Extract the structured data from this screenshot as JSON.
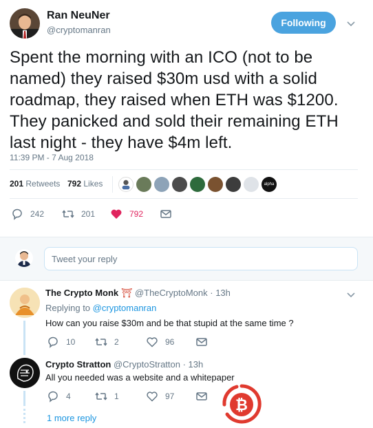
{
  "tweet": {
    "author_name": "Ran NeuNer",
    "author_handle": "@cryptomanran",
    "follow_label": "Following",
    "text_lines": [
      "Spent the morning with an ICO (not to be",
      "named) they raised $30m usd with a solid",
      "roadmap, they raised when ETH was $1200.",
      "They panicked and sold their remaining ETH",
      "last night - they have $4m left."
    ],
    "timestamp": "11:39 PM - 7 Aug 2018",
    "retweets_count": "201",
    "retweets_label": "Retweets",
    "likes_count": "792",
    "likes_label": "Likes",
    "action_reply_count": "242",
    "action_retweet_count": "201",
    "action_like_count": "792"
  },
  "reply_box": {
    "placeholder": "Tweet your reply"
  },
  "replies": [
    {
      "author_name": "The Crypto Monk",
      "author_emoji": "⛩",
      "author_handle": "@TheCryptoMonk",
      "time": "· 13h",
      "replying_prefix": "Replying to",
      "replying_to": "@cryptomanran",
      "text": "How can you raise $30m and be that stupid at the same time ?",
      "reply_count": "10",
      "retweet_count": "2",
      "like_count": "96"
    },
    {
      "author_name": "Crypto Stratton",
      "author_handle": "@CryptoStratton",
      "time": "· 13h",
      "text": "All you needed was a website and a whitepaper",
      "reply_count": "4",
      "retweet_count": "1",
      "like_count": "97"
    }
  ],
  "more_replies_link": "1 more reply",
  "likers_last_label": "alpha",
  "colors": {
    "accent": "#1b95e0",
    "follow_bg": "#4aa3df",
    "like_red": "#e0245e",
    "watermark_red": "#e03a2f"
  }
}
